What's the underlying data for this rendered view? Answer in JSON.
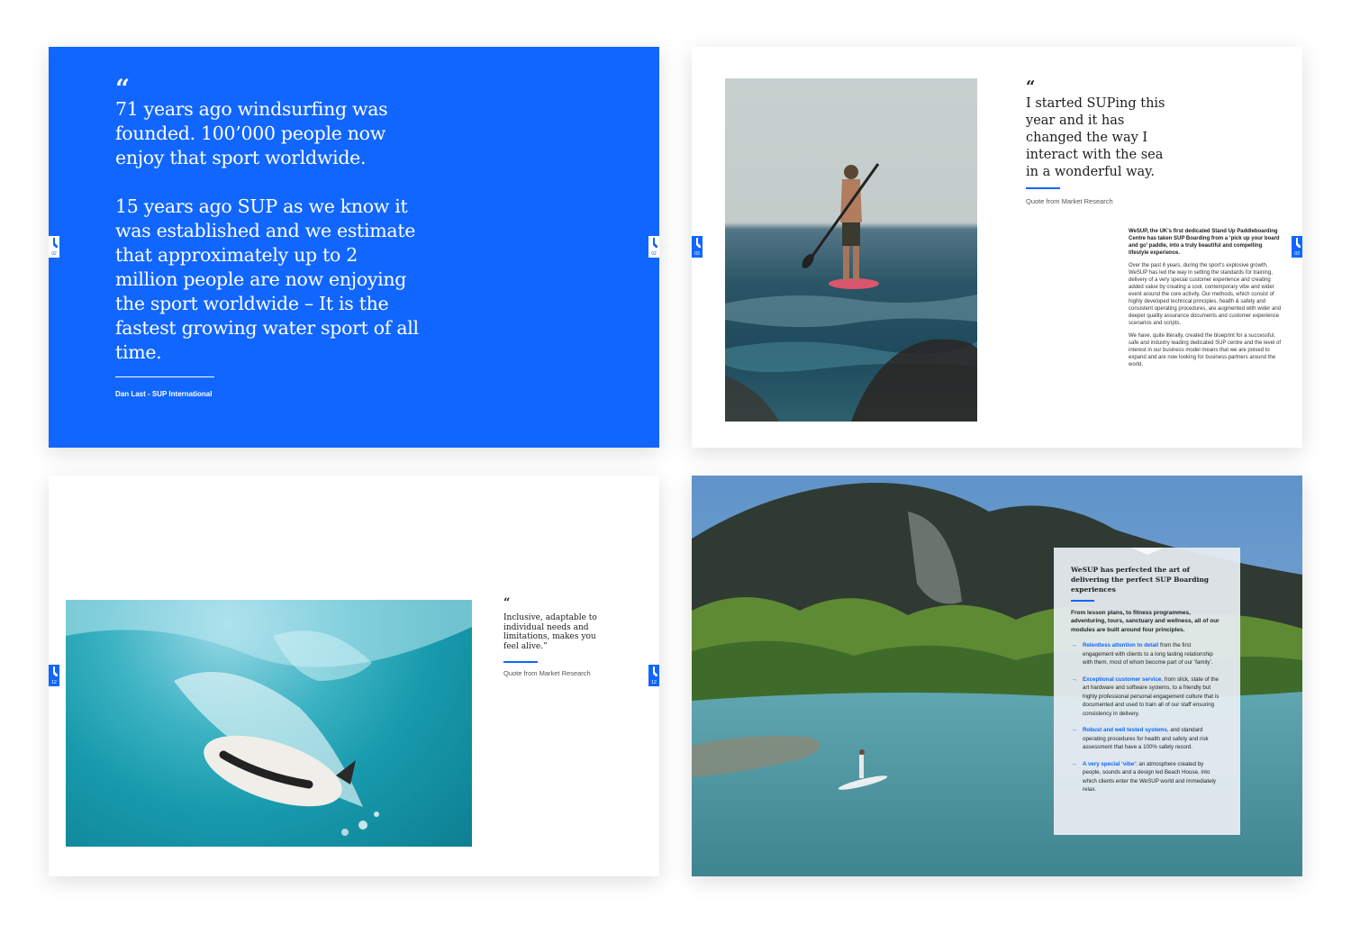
{
  "spread1": {
    "quote_mark": "“",
    "paragraphs": [
      "71 years ago windsurfing was founded. 100’000 people now enjoy that sport worldwide.",
      "15 years ago SUP as we know it was established and we estimate that approximately up to 2 million people are now enjoying the sport worldwide – It is the fastest growing water sport of all time."
    ],
    "attribution": "Dan Last - SUP International",
    "page_left": "02",
    "page_right": "02"
  },
  "spread2": {
    "quote_mark": "“",
    "quote": "I started SUPing this year and it has changed the way I interact with the sea in a wonderful way.",
    "attribution": "Quote from Market Research",
    "body": [
      "WeSUP, the UK’s first dedicated Stand Up Paddleboarding Centre has taken SUP Boarding from a ‘pick up your board and go’ paddle, into a truly beautiful and compelling lifestyle experience.",
      "Over the past 8 years, during the sport’s explosive growth, WeSUP has led the way in setting the standards for training, delivery of a very special customer experience and creating added value by creating a cool, contemporary vibe and wider event around the core activity. Our methods, which consist of highly developed technical principles, health & safety and consistent operating procedures, are augmented with wider and deeper quality assurance documents and customer experience scenarios and scripts.",
      "We have, quite literally, created the blueprint for a successful, safe and industry leading dedicated SUP centre and the level of interest in our business model means that we are poised to expand and are now looking for business partners around the world."
    ],
    "page_left": "03",
    "page_right": "03"
  },
  "spread3": {
    "quote_mark": "“",
    "quote": "Inclusive, adaptable to individual needs and limitations, makes you feel alive.”",
    "attribution": "Quote from Market Research",
    "page_left": "12",
    "page_right": "12"
  },
  "spread4": {
    "title": "WeSUP has perfected the art of delivering the perfect SUP Boarding experiences",
    "intro": "From lesson plans, to fitness programmes, adventuring, tours, sanctuary and wellness, all of our modules are built around four principles.",
    "principles": [
      {
        "highlight": "Relentless attention to detail",
        "text": " from the first engagement with clients to a long lasting relationship with them, most of whom become part of our ‘family’."
      },
      {
        "highlight": "Exceptional customer service",
        "text": ", from slick, state of the art hardware and software systems, to a friendly but highly professional personal engagement culture that is documented and used to train all of our staff ensuring consistency in delivery."
      },
      {
        "highlight": "Robust and well tested systems",
        "text": ", and standard operating procedures for health and safety and risk assessment that have a 100% safety record."
      },
      {
        "highlight": "A very special ‘vibe’",
        "text": ": an atmosphere created by people, sounds and a design led Beach House, into which clients enter the WeSUP world and immediately relax."
      }
    ],
    "arrow": "→"
  },
  "colors": {
    "brand_blue": "#1166ff",
    "text_dark": "#1d1d1d",
    "panel": "#e8eef3"
  },
  "icons": [
    "paddler-logo-icon",
    "arrow-right-icon",
    "quote-mark-icon"
  ]
}
